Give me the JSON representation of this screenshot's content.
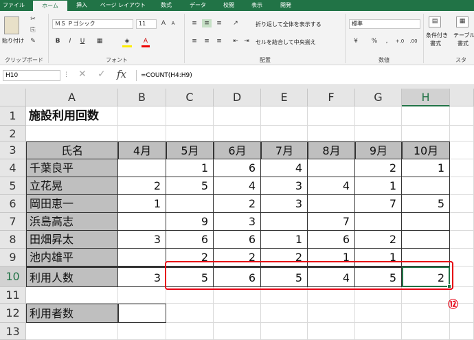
{
  "tabs": [
    "ファイル",
    "ホーム",
    "挿入",
    "ページ レイアウト",
    "数式",
    "データ",
    "校閲",
    "表示",
    "開発"
  ],
  "ribbon": {
    "paste": "貼り付け",
    "font_name": "ＭＳ Ｐゴシック",
    "font_size": "11",
    "wrap": "折り返して全体を表示する",
    "merge": "セルを結合して中央揃え",
    "number_format": "標準",
    "cond_format_1": "条件付き",
    "cond_format_2": "書式",
    "table_format_1": "テーブル",
    "table_format_2": "書式",
    "groups": {
      "clipboard": "クリップボード",
      "font": "フォント",
      "alignment": "配置",
      "number": "数値",
      "styles": "スタ"
    }
  },
  "formula_bar": {
    "name_box": "H10",
    "formula": "=COUNT(H4:H9)",
    "fx": "fx"
  },
  "columns": [
    "A",
    "B",
    "C",
    "D",
    "E",
    "F",
    "G",
    "H"
  ],
  "rows": [
    "1",
    "2",
    "3",
    "4",
    "5",
    "6",
    "7",
    "8",
    "9",
    "10",
    "11",
    "12",
    "13"
  ],
  "sheet": {
    "title": "施設利用回数",
    "name_header": "氏名",
    "months": [
      "4月",
      "5月",
      "6月",
      "7月",
      "8月",
      "9月",
      "10月"
    ],
    "people": [
      {
        "name": "千葉良平",
        "values": [
          "",
          "1",
          "6",
          "4",
          "",
          "2",
          "1"
        ]
      },
      {
        "name": "立花晃",
        "values": [
          "2",
          "5",
          "4",
          "3",
          "4",
          "1",
          ""
        ]
      },
      {
        "name": "岡田恵一",
        "values": [
          "1",
          "",
          "2",
          "3",
          "",
          "7",
          "5"
        ]
      },
      {
        "name": "浜島高志",
        "values": [
          "",
          "9",
          "3",
          "",
          "7",
          "",
          ""
        ]
      },
      {
        "name": "田畑昇太",
        "values": [
          "3",
          "6",
          "6",
          "1",
          "6",
          "2",
          ""
        ]
      },
      {
        "name": "池内雄平",
        "values": [
          "",
          "2",
          "2",
          "2",
          "1",
          "1",
          ""
        ]
      }
    ],
    "total_label": "利用人数",
    "totals": [
      "3",
      "5",
      "6",
      "5",
      "4",
      "5",
      "2"
    ],
    "users_label": "利用者数",
    "users_value": ""
  },
  "annotation": {
    "label": "⑫",
    "color": "#e60012"
  },
  "colors": {
    "accent": "#217346",
    "highlight": "#e60012",
    "header_fill": "#bfbfbf"
  }
}
